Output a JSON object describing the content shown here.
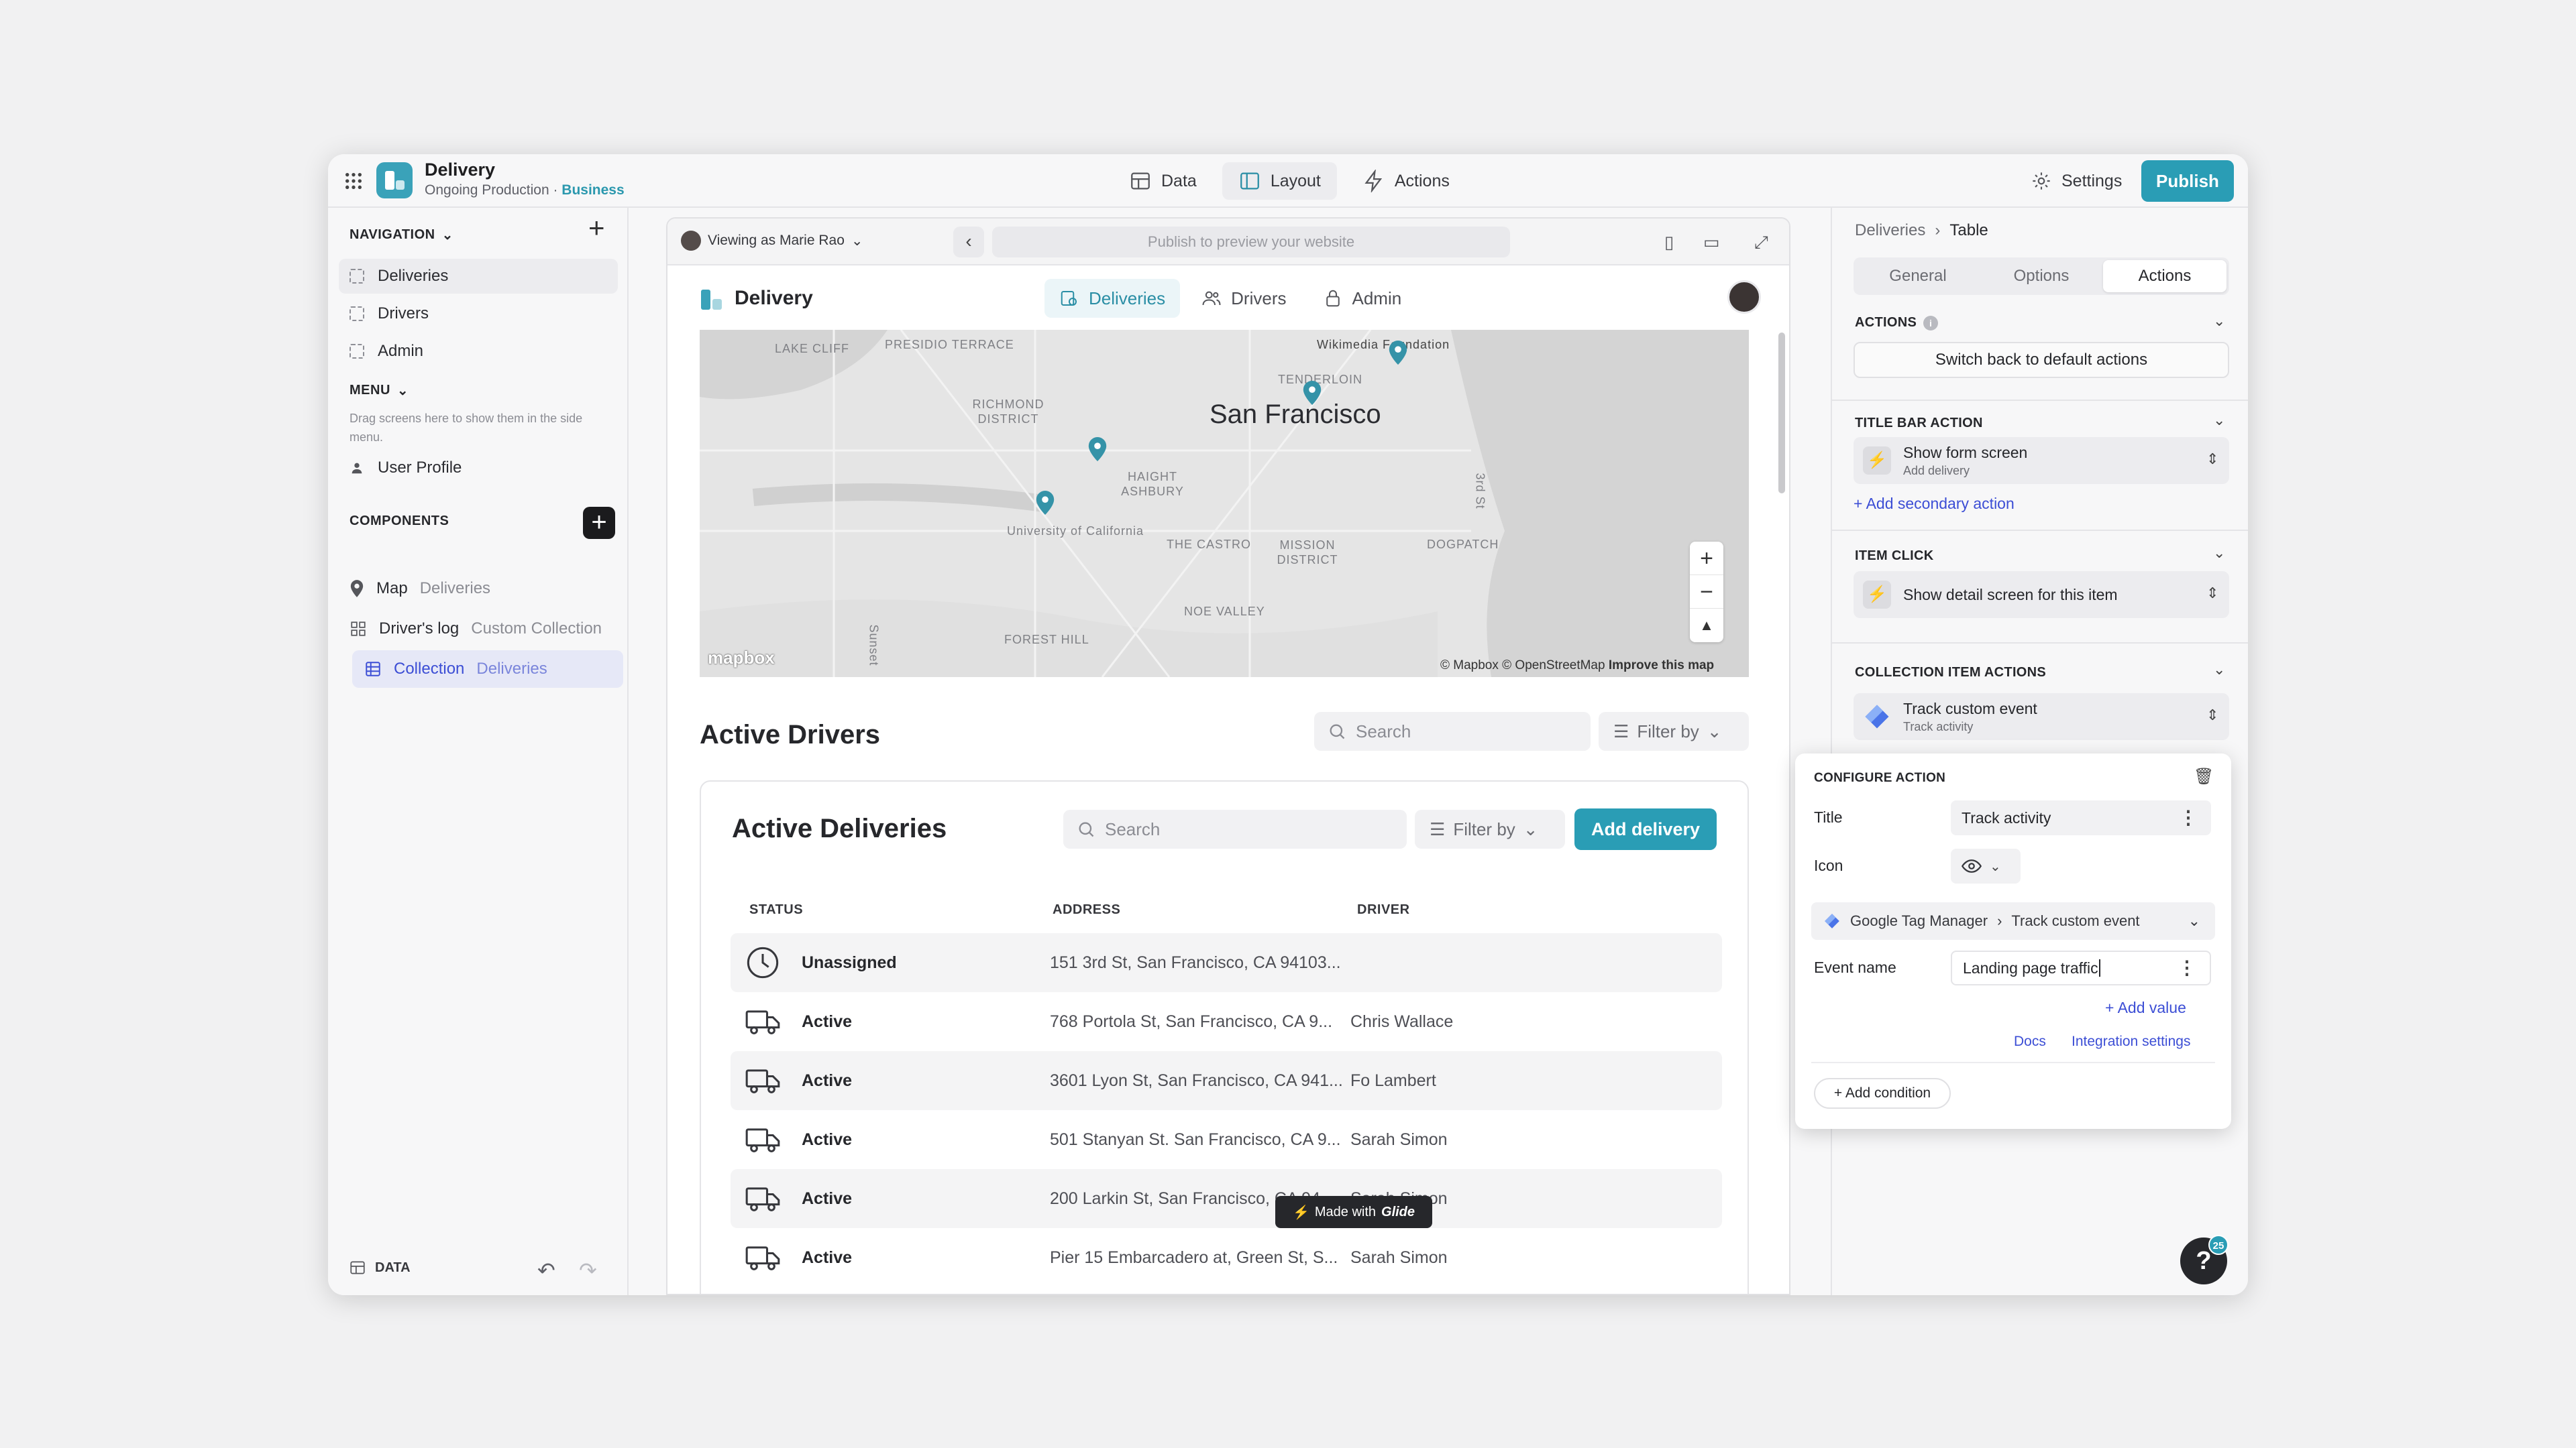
{
  "header": {
    "app_name": "Delivery",
    "app_subtitle": "Ongoing Production · ",
    "plan": "Business",
    "tabs": [
      {
        "label": "Data"
      },
      {
        "label": "Layout"
      },
      {
        "label": "Actions"
      }
    ],
    "settings_label": "Settings",
    "publish_label": "Publish"
  },
  "sidebar": {
    "navigation_title": "NAVIGATION",
    "nav_items": [
      {
        "label": "Deliveries"
      },
      {
        "label": "Drivers"
      },
      {
        "label": "Admin"
      }
    ],
    "menu_title": "MENU",
    "menu_hint": "Drag screens here to show them in the side menu.",
    "menu_items": [
      {
        "label": "User Profile"
      }
    ],
    "components_title": "COMPONENTS",
    "components": [
      {
        "label": "Map",
        "sub": "Deliveries"
      },
      {
        "label": "Driver's log",
        "sub": "Custom Collection"
      },
      {
        "label": "Collection",
        "sub": "Deliveries"
      }
    ],
    "footer_data_label": "DATA"
  },
  "preview": {
    "viewing_as": "Viewing as Marie Rao",
    "url_placeholder": "Publish to preview your website",
    "app_title": "Delivery",
    "tabs": [
      {
        "label": "Deliveries"
      },
      {
        "label": "Drivers"
      },
      {
        "label": "Admin"
      }
    ],
    "map": {
      "city": "San Francisco",
      "labels": [
        "Presidio Terrace",
        "Richmond District",
        "Haight Ashbury",
        "University of California",
        "The Castro",
        "Mission District",
        "Noe Valley",
        "Forest Hill",
        "Tenderloin",
        "Wikimedia Foundation",
        "Dogpatch",
        "Lake Cliff",
        "Sunset",
        "3rd St"
      ],
      "attribution": "© Mapbox © OpenStreetMap",
      "improve": "Improve this map",
      "logo": "mapbox"
    },
    "drivers_title": "Active Drivers",
    "search_placeholder": "Search",
    "filter_label": "Filter by",
    "deliveries_card": {
      "title": "Active Deliveries",
      "search_placeholder": "Search",
      "filter_label": "Filter by",
      "add_label": "Add delivery",
      "columns": [
        "STATUS",
        "ADDRESS",
        "DRIVER"
      ],
      "rows": [
        {
          "status": "Unassigned",
          "icon": "clock-icon",
          "address": "151 3rd St, San Francisco, CA 94103...",
          "driver": ""
        },
        {
          "status": "Active",
          "icon": "truck-icon",
          "address": "768 Portola St, San Francisco, CA 9...",
          "driver": "Chris Wallace"
        },
        {
          "status": "Active",
          "icon": "truck-icon",
          "address": "3601 Lyon St, San Francisco, CA 941...",
          "driver": "Fo Lambert"
        },
        {
          "status": "Active",
          "icon": "truck-icon",
          "address": "501 Stanyan St. San Francisco, CA 9...",
          "driver": "Sarah Simon"
        },
        {
          "status": "Active",
          "icon": "truck-icon",
          "address": "200 Larkin St, San Francisco, CA 94...",
          "driver": "Sarah Simon"
        },
        {
          "status": "Active",
          "icon": "truck-icon",
          "address": "Pier 15 Embarcadero at, Green St, S...",
          "driver": "Sarah Simon"
        }
      ]
    },
    "badge_prefix": "Made with",
    "badge_brand": "Glide"
  },
  "right_panel": {
    "breadcrumb": [
      "Deliveries",
      "Table"
    ],
    "tabs": [
      {
        "label": "General"
      },
      {
        "label": "Options"
      },
      {
        "label": "Actions"
      }
    ],
    "actions_title": "ACTIONS",
    "switch_default": "Switch back to default actions",
    "title_bar_title": "TITLE BAR ACTION",
    "title_bar_action": {
      "title": "Show form screen",
      "sub": "Add delivery"
    },
    "add_secondary": "Add secondary action",
    "item_click_title": "ITEM CLICK",
    "item_click_action": "Show detail screen for this item",
    "collection_actions_title": "COLLECTION ITEM ACTIONS",
    "collection_action": {
      "title": "Track custom event",
      "sub": "Track activity"
    }
  },
  "configure": {
    "title": "CONFIGURE ACTION",
    "title_label": "Title",
    "title_value": "Track activity",
    "icon_label": "Icon",
    "integration": "Google Tag Manager",
    "integration_action": "Track custom event",
    "event_label": "Event name",
    "event_value": "Landing page traffic",
    "add_value": "Add value",
    "docs": "Docs",
    "integration_settings": "Integration settings",
    "add_condition": "Add condition"
  },
  "help": {
    "label": "?",
    "badge": "25"
  },
  "colors": {
    "accent": "#2a9db5",
    "link": "#3c4ed5"
  }
}
